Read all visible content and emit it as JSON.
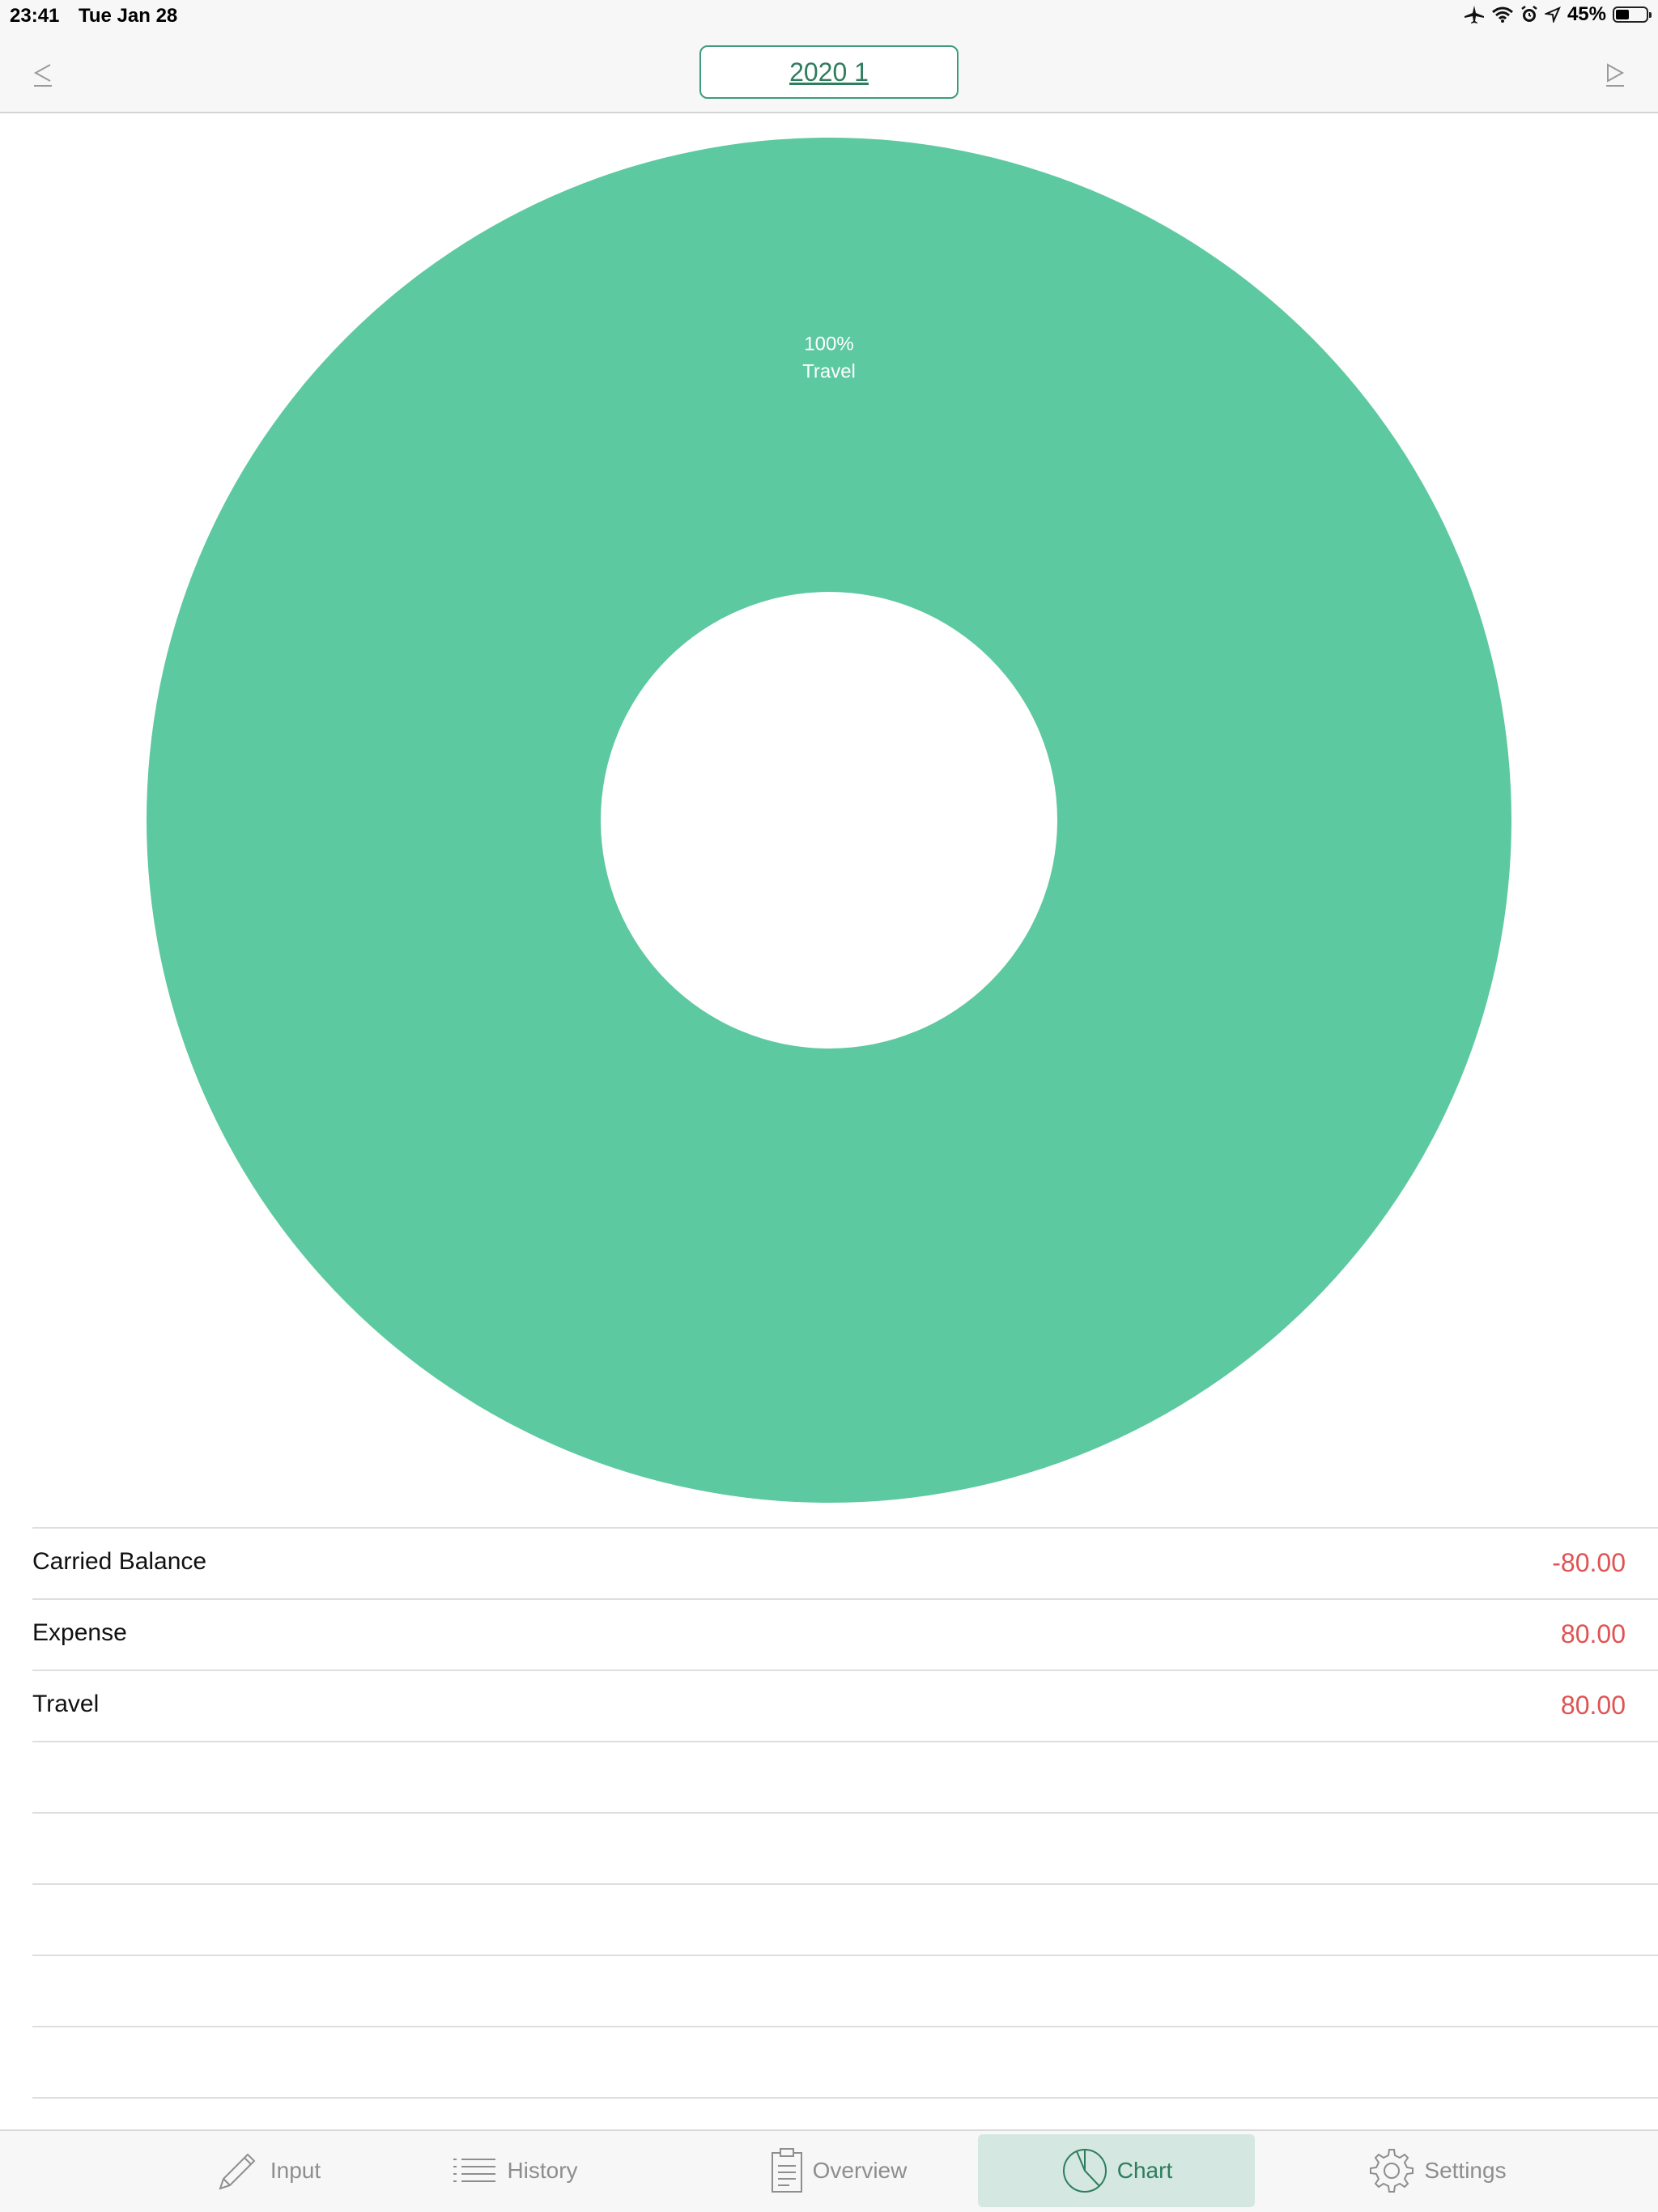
{
  "status_bar": {
    "time": "23:41",
    "date": "Tue Jan 28",
    "battery_text": "45%",
    "battery_level": 0.45,
    "icons": [
      "airplane-icon",
      "wifi-icon",
      "alarm-icon",
      "location-icon",
      "battery-icon"
    ]
  },
  "nav": {
    "period": "2020 1",
    "prev_icon": "triangle-left-icon",
    "next_icon": "triangle-right-icon"
  },
  "chart_data": {
    "type": "pie",
    "variant": "donut",
    "slices": [
      {
        "label": "Travel",
        "value": 100,
        "percent_label": "100%",
        "color": "#5dc9a0"
      }
    ]
  },
  "summary": {
    "rows": [
      {
        "label": "Carried Balance",
        "value": "-80.00"
      },
      {
        "label": "Expense",
        "value": "80.00"
      },
      {
        "label": "Travel",
        "value": "80.00"
      }
    ]
  },
  "tabs": [
    {
      "label": "Input",
      "icon": "pencil-icon",
      "active": false
    },
    {
      "label": "History",
      "icon": "list-icon",
      "active": false
    },
    {
      "label": "Overview",
      "icon": "clipboard-icon",
      "active": false
    },
    {
      "label": "Chart",
      "icon": "pie-chart-icon",
      "active": true
    },
    {
      "label": "Settings",
      "icon": "gear-icon",
      "active": false
    }
  ],
  "colors": {
    "accent": "#2e7d5e",
    "chart_green": "#5dc9a0",
    "negative_value": "#e05353",
    "active_tab_bg": "#d4e7e0"
  }
}
